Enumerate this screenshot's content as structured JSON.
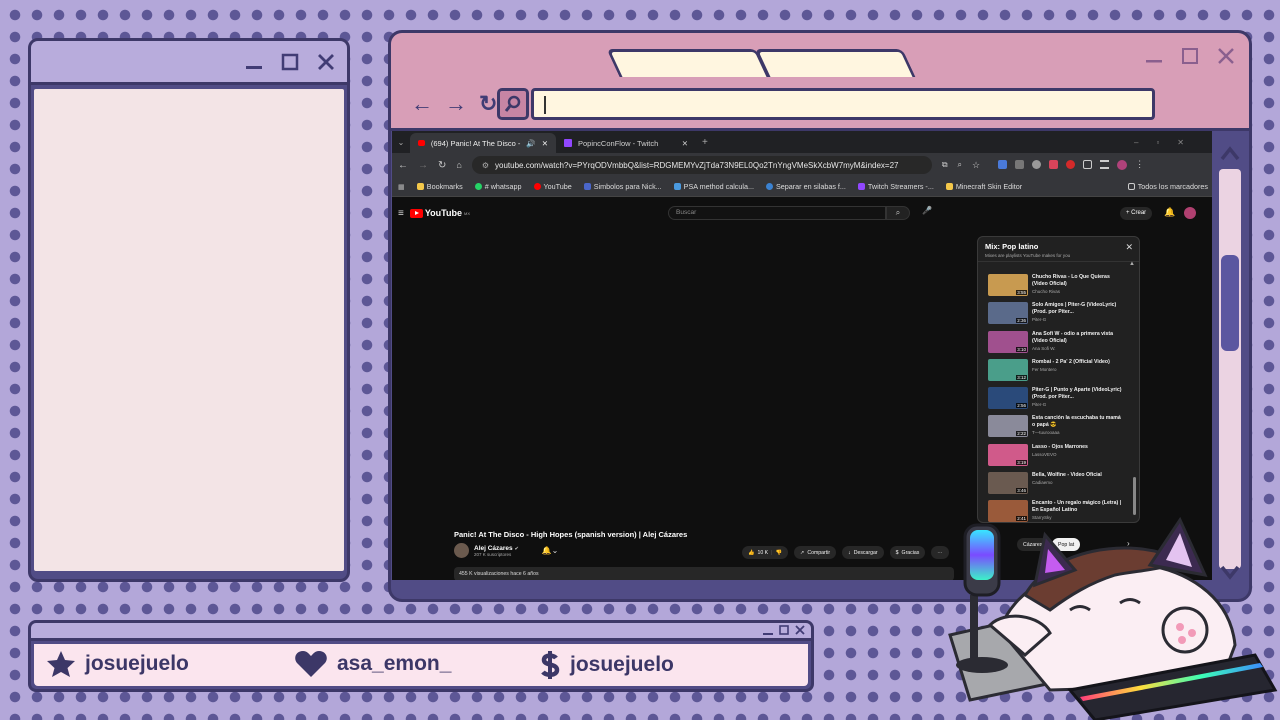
{
  "browser": {
    "tabs": [
      {
        "label": "(694) Panic! At The Disco -"
      },
      {
        "label": "PopincConFlow - Twitch"
      }
    ],
    "url": "youtube.com/watch?v=PYrqODVmbbQ&list=RDGMEMYvZjTda73N9EL0Qo2TnYngVMeSkXcbW7myM&index=27",
    "bookmarks": [
      {
        "label": "Bookmarks",
        "color": "#f4c84a"
      },
      {
        "label": "# whatsapp",
        "color": "#25d366"
      },
      {
        "label": "YouTube",
        "color": "#ff0000"
      },
      {
        "label": "Simbolos para Nick...",
        "color": "#4a66c9"
      },
      {
        "label": "PSA method calcula...",
        "color": "#4a9ae0"
      },
      {
        "label": "Separar en silabas f...",
        "color": "#3b82d1"
      },
      {
        "label": "Twitch Streamers -...",
        "color": "#9147ff"
      },
      {
        "label": "Minecraft Skin Editor",
        "color": "#f4c84a"
      }
    ],
    "all_bookmarks_label": "Todos los marcadores"
  },
  "youtube": {
    "logo": "YouTube",
    "country": "MX",
    "search_placeholder": "Buscar",
    "create_label": "Crear",
    "video_title": "Panic! At The Disco - High Hopes (spanish version) | Alej Cázares",
    "channel": "Alej Cázares",
    "subscribers": "207 K suscriptores",
    "likes": "10 K",
    "share_label": "Compartir",
    "download_label": "Descargar",
    "thanks_label": "Gracias",
    "description": "455 K visualizaciones  hace 6 años",
    "playlist": {
      "title": "Mix: Pop latino",
      "subtitle": "Mixes are playlists YouTube makes for you",
      "items": [
        {
          "title": "Chucho Rivas - Lo Que Quieras (Video Oficial)",
          "channel": "Chucho Rivas",
          "duration": "3:55",
          "color": "#c89a50"
        },
        {
          "title": "Solo Amigos | Piter-G (VideoLyric) (Prod. por Piter...",
          "channel": "Piter-G",
          "duration": "2:36",
          "color": "#5a6a8a"
        },
        {
          "title": "Ana Sofi W - odio a primera vista (Video Oficial)",
          "channel": "Ana Sofi W.",
          "duration": "3:10",
          "color": "#a0508e"
        },
        {
          "title": "Rombai - 2 Pa' 2 (Official Video)",
          "channel": "Fer Montero",
          "duration": "3:12",
          "color": "#4a9e8a"
        },
        {
          "title": "Piter-G | Punto y Aparte (VideoLyric) (Prod. por Piter...",
          "channel": "Piter-G",
          "duration": "2:56",
          "color": "#2a4a7a"
        },
        {
          "title": "Esta canción la escuchaba tu mamá o papá 😎",
          "channel": "T—tuurooaaa",
          "duration": "2:22",
          "color": "#8a8a9a"
        },
        {
          "title": "Lasso - Ojos Marrones",
          "channel": "LassoVEVO",
          "duration": "3:19",
          "color": "#d05a8a"
        },
        {
          "title": "Bellа, Wolfine - Video Oficial",
          "channel": "Cadiaemo",
          "duration": "3:46",
          "color": "#6a5a50"
        },
        {
          "title": "Encanto - Un regalo mágico (Letra) | En Español Latino",
          "channel": "StarrySky",
          "duration": "2:41",
          "color": "#9a5a3a"
        }
      ]
    },
    "chips": {
      "first": "Cázares",
      "second": "Pop lat"
    }
  },
  "social": {
    "twitter": "josuejuelo",
    "heart": "asa_emon_",
    "donate": "josuejuelo"
  },
  "colors": {
    "background": "#b3a7d9",
    "dots": "#5d5796",
    "frame_dark": "#3d3868",
    "frame_pink": "#d89eb7",
    "cream": "#fff6e0"
  }
}
